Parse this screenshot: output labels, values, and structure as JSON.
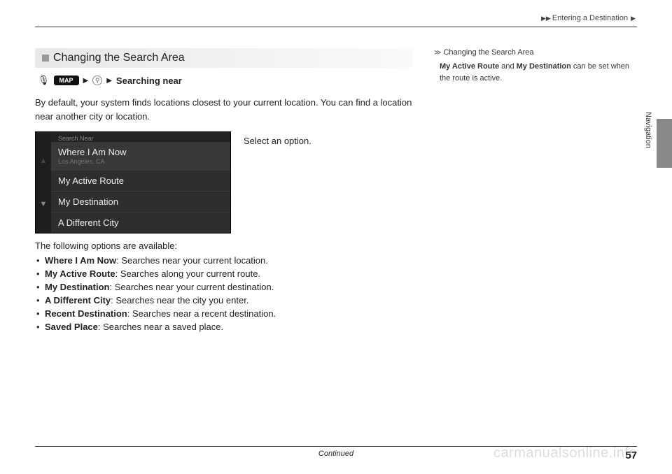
{
  "header": {
    "breadcrumb_parent": "Entering a Destination",
    "chevron": "▶"
  },
  "section": {
    "title": "Changing the Search Area",
    "nav": {
      "map_label": "MAP",
      "search_icon_label": "⚲",
      "trailing_label": "Searching near"
    },
    "intro": "By default, your system finds locations closest to your current location. You can find a location near another city or location.",
    "instruction": "Select an option.",
    "screenshot": {
      "header": "Search Near",
      "item1": "Where I Am Now",
      "item1_sub": "Los Angeles, CA",
      "item2": "My Active Route",
      "item3": "My Destination",
      "item4": "A Different City"
    },
    "follow": "The following options are available:",
    "options": {
      "o1_name": "Where I Am Now",
      "o1_desc": ": Searches near your current location.",
      "o2_name": "My Active Route",
      "o2_desc": ": Searches along your current route.",
      "o3_name": "My Destination",
      "o3_desc": ": Searches near your current destination.",
      "o4_name": "A Different City",
      "o4_desc": ": Searches near the city you enter.",
      "o5_name": "Recent Destination",
      "o5_desc": ": Searches near a recent destination.",
      "o6_name": "Saved Place",
      "o6_desc": ": Searches near a saved place."
    }
  },
  "sidebar": {
    "heading": "Changing the Search Area",
    "body_strong1": "My Active Route",
    "body_mid": " and ",
    "body_strong2": "My Destination",
    "body_tail": " can be set when the route is active."
  },
  "tab": {
    "label": "Navigation"
  },
  "footer": {
    "continued": "Continued",
    "page": "57",
    "watermark": "carmanualsonline.info"
  }
}
